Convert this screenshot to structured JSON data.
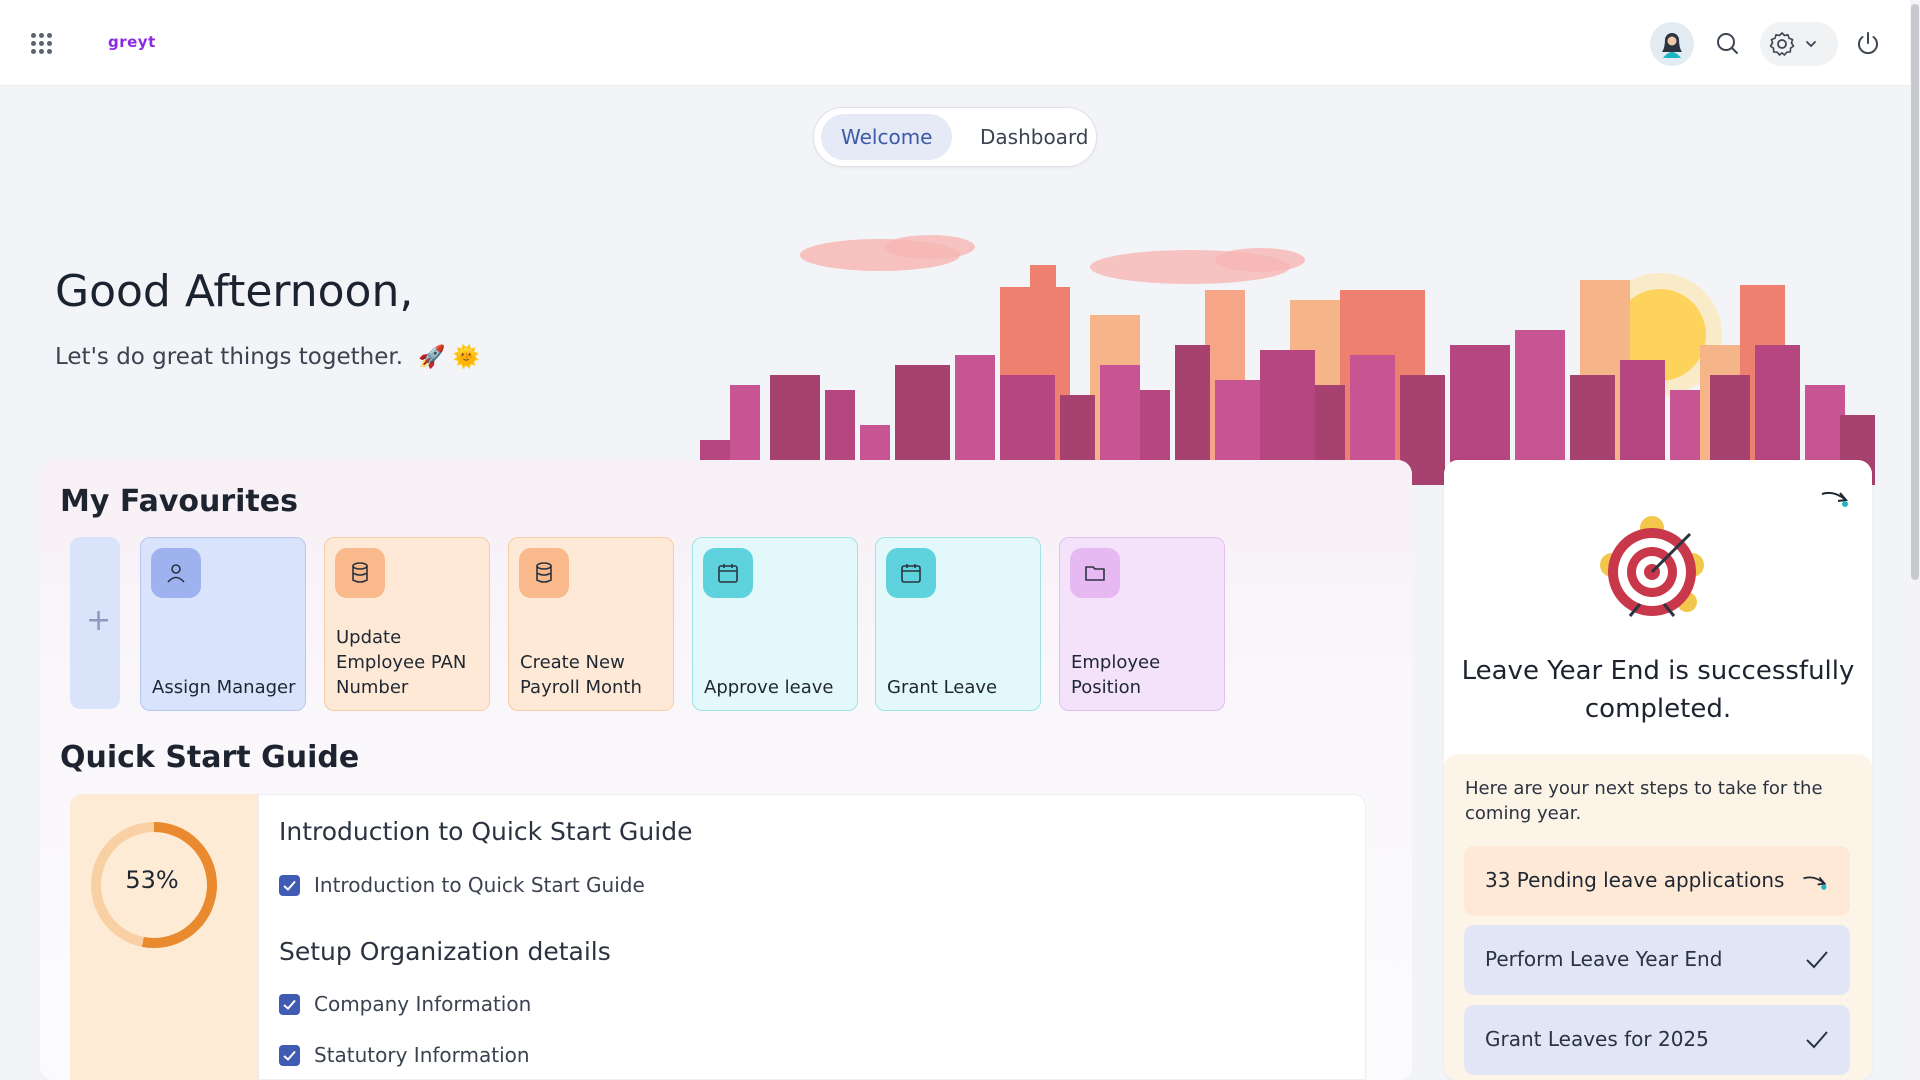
{
  "header": {
    "logo_text": "greyt",
    "icons": [
      "apps-grid-icon",
      "avatar",
      "search-icon",
      "gear-icon",
      "chevron-down-icon",
      "power-icon"
    ]
  },
  "view_toggle": {
    "options": [
      {
        "label": "Welcome",
        "active": true
      },
      {
        "label": "Dashboard",
        "active": false
      }
    ]
  },
  "greeting": {
    "title": "Good Afternoon,",
    "subtitle": "Let's do great things together.",
    "emojis": "🚀 🌞"
  },
  "favourites": {
    "title": "My Favourites",
    "items": [
      {
        "label": "Assign Manager",
        "icon": "user-icon",
        "color": "#d6e0fb"
      },
      {
        "label": "Update Employee PAN Number",
        "icon": "database-icon",
        "color": "#fde9d6"
      },
      {
        "label": "Create New Payroll Month",
        "icon": "database-icon",
        "color": "#fde9d6"
      },
      {
        "label": "Approve leave",
        "icon": "calendar-icon",
        "color": "#e3f8fb"
      },
      {
        "label": "Grant Leave",
        "icon": "calendar-icon",
        "color": "#e3f8fb"
      },
      {
        "label": "Employee Position",
        "icon": "folder-icon",
        "color": "#f4e1fa"
      }
    ]
  },
  "quick_start": {
    "title": "Quick Start Guide",
    "progress_label": "53%",
    "progress_value": 0.53,
    "sections": [
      {
        "heading": "Introduction to Quick Start Guide",
        "items": [
          "Introduction to Quick Start Guide"
        ]
      },
      {
        "heading": "Setup Organization details",
        "items": [
          "Company Information",
          "Statutory Information"
        ]
      }
    ]
  },
  "leave_year": {
    "title": "Leave Year End is successfully completed.",
    "next_steps_text": "Here are your next steps to take for the coming year.",
    "steps": [
      {
        "label": "33 Pending leave applications",
        "icon": "arrow-icon"
      },
      {
        "label": "Perform Leave Year End",
        "icon": "check-icon"
      },
      {
        "label": "Grant Leaves for 2025",
        "icon": "check-icon"
      }
    ]
  },
  "colors": {
    "accent": "#3f5bb4",
    "progress": "#e98a2f",
    "brand": "#8a2be2"
  }
}
